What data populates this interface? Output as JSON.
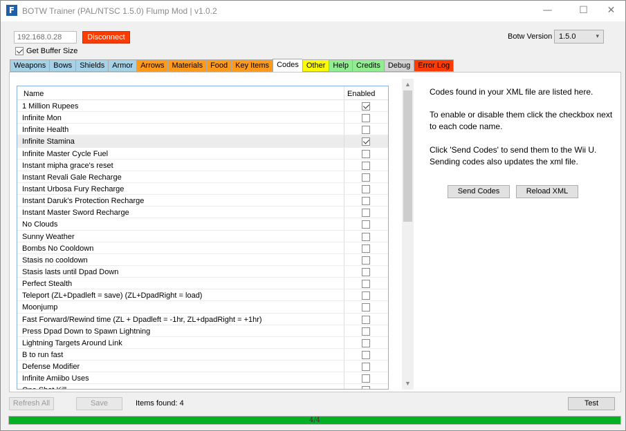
{
  "window": {
    "title": "BOTW Trainer (PAL/NTSC 1.5.0) Flump Mod | v1.0.2",
    "icon_letter": "F",
    "minimize_glyph": "—",
    "maximize_glyph": "☐",
    "close_glyph": "✕"
  },
  "connection": {
    "ip_value": "192.168.0.28",
    "disconnect_label": "Disconnect",
    "disconnect_color": "#ff3b00",
    "get_buffer_label": "Get Buffer Size",
    "get_buffer_checked": true
  },
  "version": {
    "label": "Botw Version",
    "selected": "1.5.0"
  },
  "tabs": [
    {
      "label": "Weapons",
      "color": "#a6d2e8"
    },
    {
      "label": "Bows",
      "color": "#a6d2e8"
    },
    {
      "label": "Shields",
      "color": "#a6d2e8"
    },
    {
      "label": "Armor",
      "color": "#a6d2e8"
    },
    {
      "label": "Arrows",
      "color": "#ff9a1a"
    },
    {
      "label": "Materials",
      "color": "#ff9a1a"
    },
    {
      "label": "Food",
      "color": "#ff9a1a"
    },
    {
      "label": "Key Items",
      "color": "#ff9a1a"
    },
    {
      "label": "Codes",
      "color": "#ffffff",
      "active": true
    },
    {
      "label": "Other",
      "color": "#ffff00"
    },
    {
      "label": "Help",
      "color": "#90ee90"
    },
    {
      "label": "Credits",
      "color": "#90ee90"
    },
    {
      "label": "Debug",
      "color": "#d3d3d3"
    },
    {
      "label": "Error Log",
      "color": "#ff3b00"
    }
  ],
  "codes": {
    "header_name": "Name",
    "header_enabled": "Enabled",
    "rows": [
      {
        "name": "1 Million Rupees",
        "enabled": true
      },
      {
        "name": "Infinite Mon",
        "enabled": false
      },
      {
        "name": "Infinite Health",
        "enabled": false
      },
      {
        "name": "Infinite Stamina",
        "enabled": true,
        "selected": true
      },
      {
        "name": "Infinite Master Cycle Fuel",
        "enabled": false
      },
      {
        "name": "Instant mipha grace's reset",
        "enabled": false
      },
      {
        "name": "Instant Revali Gale Recharge",
        "enabled": false
      },
      {
        "name": "Instant Urbosa Fury Recharge",
        "enabled": false
      },
      {
        "name": "Instant Daruk's Protection Recharge",
        "enabled": false
      },
      {
        "name": "Instant Master Sword Recharge",
        "enabled": false
      },
      {
        "name": "No Clouds",
        "enabled": false
      },
      {
        "name": "Sunny Weather",
        "enabled": false
      },
      {
        "name": "Bombs No Cooldown",
        "enabled": false
      },
      {
        "name": "Stasis no cooldown",
        "enabled": false
      },
      {
        "name": "Stasis lasts until Dpad Down",
        "enabled": false
      },
      {
        "name": "Perfect Stealth",
        "enabled": false
      },
      {
        "name": "Teleport (ZL+Dpadleft = save) (ZL+DpadRight = load)",
        "enabled": false
      },
      {
        "name": "Moonjump",
        "enabled": false
      },
      {
        "name": "Fast Forward/Rewind time (ZL + Dpadleft = -1hr, ZL+dpadRight = +1hr)",
        "enabled": false
      },
      {
        "name": "Press Dpad Down to Spawn Lightning",
        "enabled": false
      },
      {
        "name": "Lightning Targets Around Link",
        "enabled": false
      },
      {
        "name": "B to run fast",
        "enabled": false
      },
      {
        "name": "Defense Modifier",
        "enabled": false
      },
      {
        "name": "Infinite Amiibo Uses",
        "enabled": false
      },
      {
        "name": "One Shot Kill",
        "enabled": false
      }
    ]
  },
  "info": {
    "line1": "Codes found in your XML file are listed here.",
    "line2": "To enable or disable them click the checkbox next to each code name.",
    "line3": "Click 'Send Codes' to send them to the Wii U. Sending codes also updates the xml file.",
    "send_codes_label": "Send Codes",
    "reload_xml_label": "Reload XML"
  },
  "footer": {
    "refresh_label": "Refresh All",
    "save_label": "Save",
    "items_found": "Items found: 4",
    "test_label": "Test",
    "progress_text": "4/4",
    "progress_fraction": 1.0,
    "progress_color": "#06b025"
  }
}
